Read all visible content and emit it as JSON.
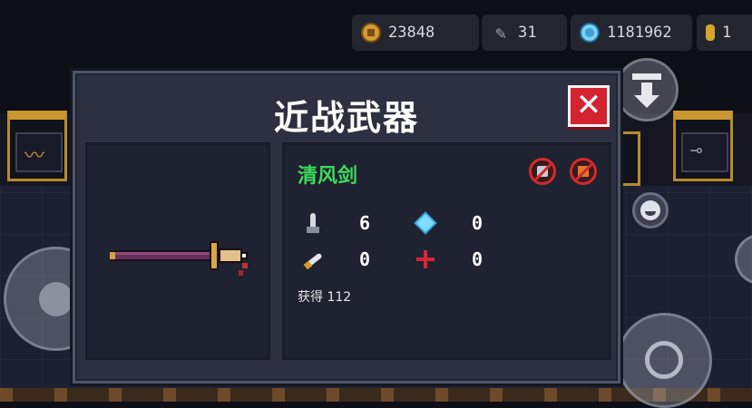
{
  "resources": {
    "coins": "23848",
    "materials": "31",
    "gems": "1181962",
    "tokens": "1"
  },
  "dialog": {
    "title": "近战武器",
    "close_label": "✕",
    "weapon": {
      "name": "清风剑",
      "name_color": "#3ddc5a",
      "stats": {
        "damage": "6",
        "energy_cost": "0",
        "crit_chance": "0",
        "accuracy_spread": "0"
      },
      "obtained_label": "获得",
      "obtained_count": "112"
    }
  },
  "icons": {
    "coin": "coin-icon",
    "material": "feather-icon",
    "gem": "gem-icon",
    "token": "token-icon",
    "damage": "sword-icon",
    "energy": "diamond-icon",
    "crit": "knife-icon",
    "accuracy": "crosshair-icon",
    "tag_no_hammer": "no-hammer-icon",
    "tag_no_fire": "no-fire-icon",
    "drop": "drop-down-icon",
    "emote": "smiley-icon",
    "attack": "crosshair-icon"
  },
  "colors": {
    "close_button": "#d32230",
    "panel": "#2c3040",
    "accent_gold": "#b88a2c"
  }
}
